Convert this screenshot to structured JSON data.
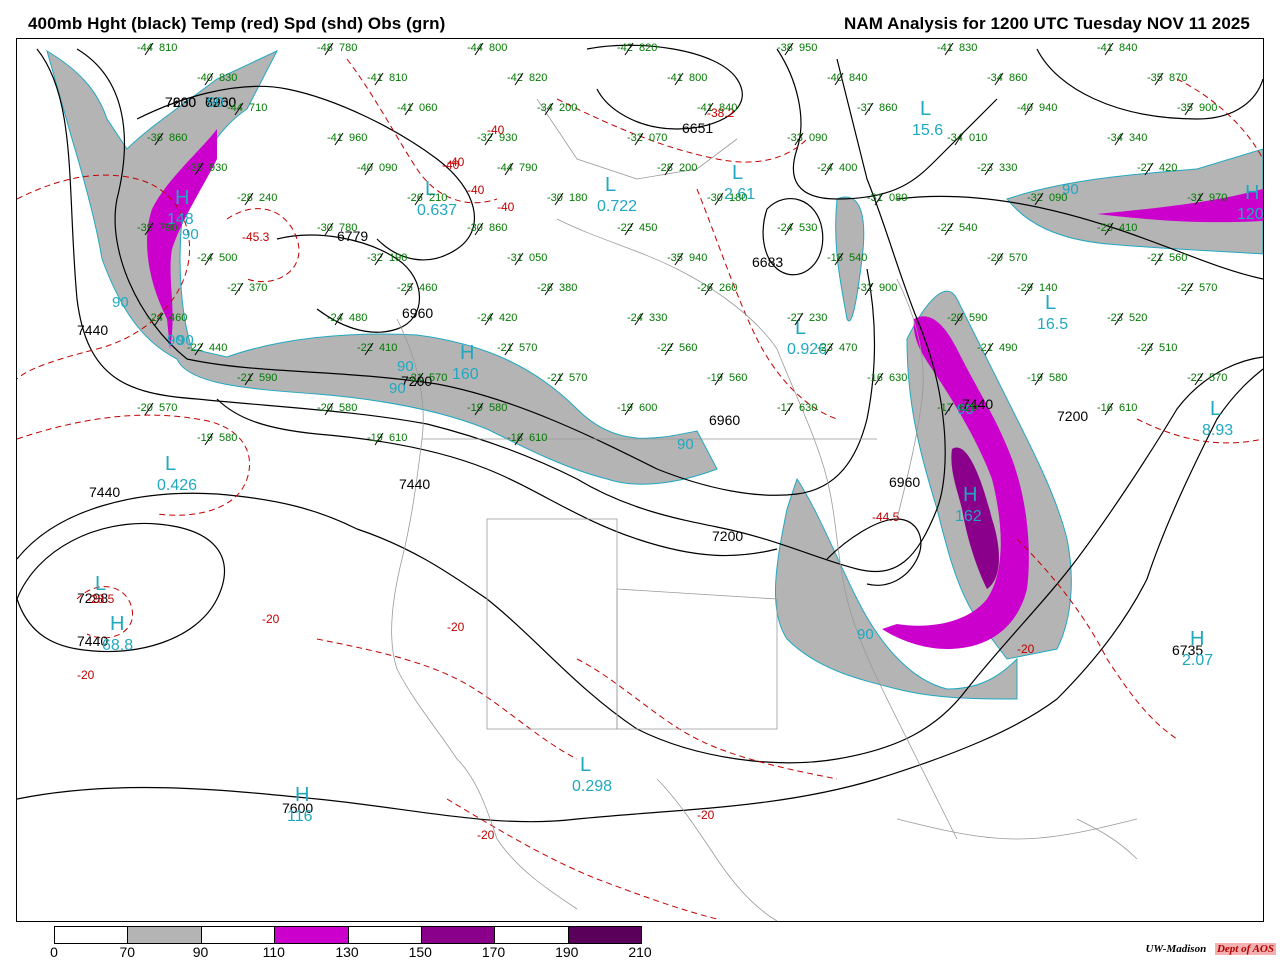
{
  "header": {
    "left_title": "400mb Hght (black) Temp (red) Spd (shd) Obs (grn)",
    "right_title": "NAM Analysis for 1200 UTC Tuesday  NOV 11 2025"
  },
  "colors": {
    "height_contour": "#000000",
    "temp_contour": "#c00000",
    "speed_70_90": "#b4b4b4",
    "speed_110_130": "#cc00cc",
    "speed_150_170": "#8b008b",
    "speed_190_210": "#5a005a",
    "obs": "#007a00",
    "max_min_label": "#20a8c0",
    "geography": "#999999"
  },
  "legend": {
    "ticks": [
      "0",
      "70",
      "90",
      "110",
      "130",
      "150",
      "170",
      "190",
      "210"
    ],
    "segment_colors": [
      "#ffffff",
      "#b4b4b4",
      "#ffffff",
      "#cc00cc",
      "#ffffff",
      "#8b008b",
      "#ffffff",
      "#5a005a"
    ]
  },
  "credit": {
    "org": "UW-Madison",
    "dept": "Dept of AOS"
  },
  "map": {
    "height_labels": [
      "7200",
      "6960",
      "7440",
      "6779",
      "6960",
      "7200",
      "7440",
      "7440",
      "7298",
      "7440",
      "7600",
      "6651",
      "6683",
      "6960",
      "7200",
      "6960",
      "7200",
      "6735",
      "7440",
      "7630",
      "7200"
    ],
    "temp_labels": [
      "-45.3",
      "-40",
      "-40",
      "-40",
      "-40",
      "-40",
      "-38.2",
      "-44.5",
      "-20",
      "-20",
      "-20",
      "-20",
      "-20",
      "-20",
      "-28.5"
    ],
    "speed_labels": [
      "90",
      "90",
      "90",
      "90",
      "90",
      "90",
      "90",
      "90",
      "90",
      "90",
      "90"
    ],
    "extrema": [
      {
        "letter": "H",
        "value": "148"
      },
      {
        "letter": "L",
        "value": "0.637"
      },
      {
        "letter": "L",
        "value": "0.722"
      },
      {
        "letter": "L",
        "value": "2.61"
      },
      {
        "letter": "L",
        "value": "15.6"
      },
      {
        "letter": "L",
        "value": "0.926"
      },
      {
        "letter": "L",
        "value": "16.5"
      },
      {
        "letter": "L",
        "value": "8.93"
      },
      {
        "letter": "L",
        "value": "0.426"
      },
      {
        "letter": "L",
        "value": ""
      },
      {
        "letter": "H",
        "value": "68.8"
      },
      {
        "letter": "H",
        "value": "116"
      },
      {
        "letter": "L",
        "value": "0.298"
      },
      {
        "letter": "H",
        "value": "162"
      },
      {
        "letter": "H",
        "value": "2.07"
      },
      {
        "letter": "H",
        "value": "120"
      },
      {
        "letter": "H",
        "value": "160"
      }
    ],
    "obs": [
      {
        "temp": "-44",
        "hgt": "810"
      },
      {
        "temp": "-48",
        "hgt": "780"
      },
      {
        "temp": "-44",
        "hgt": "800"
      },
      {
        "temp": "-42",
        "hgt": "820"
      },
      {
        "temp": "-38",
        "hgt": "950"
      },
      {
        "temp": "-41",
        "hgt": "830"
      },
      {
        "temp": "-41",
        "hgt": "840"
      },
      {
        "temp": "-40",
        "hgt": "830"
      },
      {
        "temp": "-41",
        "hgt": "810"
      },
      {
        "temp": "-42",
        "hgt": "820"
      },
      {
        "temp": "-41",
        "hgt": "800"
      },
      {
        "temp": "-40",
        "hgt": "840"
      },
      {
        "temp": "-34",
        "hgt": "860"
      },
      {
        "temp": "-35",
        "hgt": "870"
      },
      {
        "temp": "-44",
        "hgt": "710"
      },
      {
        "temp": "-41",
        "hgt": "060"
      },
      {
        "temp": "-34",
        "hgt": "200"
      },
      {
        "temp": "-41",
        "hgt": "840"
      },
      {
        "temp": "-37",
        "hgt": "860"
      },
      {
        "temp": "-40",
        "hgt": "940"
      },
      {
        "temp": "-35",
        "hgt": "900"
      },
      {
        "temp": "-38",
        "hgt": "860"
      },
      {
        "temp": "-41",
        "hgt": "960"
      },
      {
        "temp": "-32",
        "hgt": "930"
      },
      {
        "temp": "-32",
        "hgt": "070"
      },
      {
        "temp": "-33",
        "hgt": "090"
      },
      {
        "temp": "-34",
        "hgt": "010"
      },
      {
        "temp": "-34",
        "hgt": "340"
      },
      {
        "temp": "-35",
        "hgt": "930"
      },
      {
        "temp": "-40",
        "hgt": "090"
      },
      {
        "temp": "-44",
        "hgt": "790"
      },
      {
        "temp": "-28",
        "hgt": "200"
      },
      {
        "temp": "-24",
        "hgt": "400"
      },
      {
        "temp": "-23",
        "hgt": "330"
      },
      {
        "temp": "-27",
        "hgt": "420"
      },
      {
        "temp": "-28",
        "hgt": "240"
      },
      {
        "temp": "-26",
        "hgt": "210"
      },
      {
        "temp": "-30",
        "hgt": "180"
      },
      {
        "temp": "-30",
        "hgt": "180"
      },
      {
        "temp": "-31",
        "hgt": "080"
      },
      {
        "temp": "-32",
        "hgt": "090"
      },
      {
        "temp": "-31",
        "hgt": "970"
      },
      {
        "temp": "-39",
        "hgt": "790"
      },
      {
        "temp": "-30",
        "hgt": "780"
      },
      {
        "temp": "-30",
        "hgt": "860"
      },
      {
        "temp": "-22",
        "hgt": "450"
      },
      {
        "temp": "-24",
        "hgt": "530"
      },
      {
        "temp": "-22",
        "hgt": "540"
      },
      {
        "temp": "-23",
        "hgt": "410"
      },
      {
        "temp": "-24",
        "hgt": "500"
      },
      {
        "temp": "-32",
        "hgt": "190"
      },
      {
        "temp": "-31",
        "hgt": "050"
      },
      {
        "temp": "-35",
        "hgt": "940"
      },
      {
        "temp": "-18",
        "hgt": "540"
      },
      {
        "temp": "-20",
        "hgt": "570"
      },
      {
        "temp": "-21",
        "hgt": "560"
      },
      {
        "temp": "-27",
        "hgt": "370"
      },
      {
        "temp": "-25",
        "hgt": "460"
      },
      {
        "temp": "-28",
        "hgt": "380"
      },
      {
        "temp": "-26",
        "hgt": "260"
      },
      {
        "temp": "-32",
        "hgt": "900"
      },
      {
        "temp": "-29",
        "hgt": "140"
      },
      {
        "temp": "-22",
        "hgt": "570"
      },
      {
        "temp": "-24",
        "hgt": "460"
      },
      {
        "temp": "-24",
        "hgt": "480"
      },
      {
        "temp": "-24",
        "hgt": "420"
      },
      {
        "temp": "-24",
        "hgt": "330"
      },
      {
        "temp": "-27",
        "hgt": "230"
      },
      {
        "temp": "-20",
        "hgt": "590"
      },
      {
        "temp": "-23",
        "hgt": "520"
      },
      {
        "temp": "-22",
        "hgt": "440"
      },
      {
        "temp": "-22",
        "hgt": "410"
      },
      {
        "temp": "-21",
        "hgt": "570"
      },
      {
        "temp": "-22",
        "hgt": "560"
      },
      {
        "temp": "-23",
        "hgt": "470"
      },
      {
        "temp": "-21",
        "hgt": "490"
      },
      {
        "temp": "-23",
        "hgt": "510"
      },
      {
        "temp": "-21",
        "hgt": "590"
      },
      {
        "temp": "-21",
        "hgt": "570"
      },
      {
        "temp": "-21",
        "hgt": "570"
      },
      {
        "temp": "-19",
        "hgt": "560"
      },
      {
        "temp": "-16",
        "hgt": "630"
      },
      {
        "temp": "-19",
        "hgt": "580"
      },
      {
        "temp": "-22",
        "hgt": "570"
      },
      {
        "temp": "-20",
        "hgt": "570"
      },
      {
        "temp": "-20",
        "hgt": "580"
      },
      {
        "temp": "-19",
        "hgt": "580"
      },
      {
        "temp": "-19",
        "hgt": "600"
      },
      {
        "temp": "-17",
        "hgt": "630"
      },
      {
        "temp": "-17",
        "hgt": "620"
      },
      {
        "temp": "-16",
        "hgt": "610"
      },
      {
        "temp": "-19",
        "hgt": "580"
      },
      {
        "temp": "-19",
        "hgt": "610"
      },
      {
        "temp": "-18",
        "hgt": "610"
      }
    ]
  }
}
